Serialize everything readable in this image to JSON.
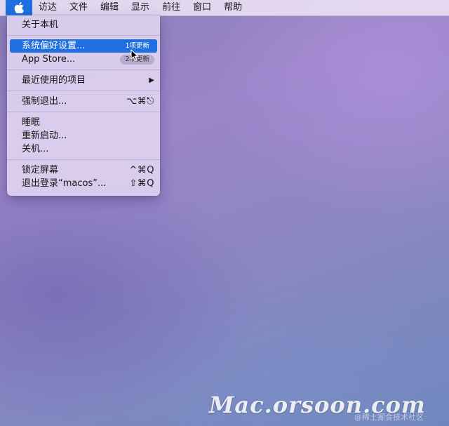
{
  "menubar": {
    "apple_icon": "apple-logo-icon",
    "items": [
      "访达",
      "文件",
      "编辑",
      "显示",
      "前往",
      "窗口",
      "帮助"
    ]
  },
  "apple_menu": {
    "about": "关于本机",
    "system_prefs": {
      "label": "系统偏好设置...",
      "badge": "1项更新"
    },
    "app_store": {
      "label": "App Store...",
      "badge": "2项更新"
    },
    "recent_items": {
      "label": "最近使用的项目",
      "arrow": "▶"
    },
    "force_quit": {
      "label": "强制退出...",
      "shortcut": "⌥⌘⎋"
    },
    "sleep": "睡眠",
    "restart": "重新启动...",
    "shutdown": "关机...",
    "lock_screen": {
      "label": "锁定屏幕",
      "shortcut": "^⌘Q"
    },
    "log_out": {
      "label": "退出登录“macos”...",
      "shortcut": "⇧⌘Q"
    }
  },
  "watermark": {
    "main": "Mac.orsoon.com",
    "sub": "@稀土掘金技术社区"
  },
  "colors": {
    "highlight": "#1f6fe0",
    "menu_bg": "#ded2f0"
  }
}
